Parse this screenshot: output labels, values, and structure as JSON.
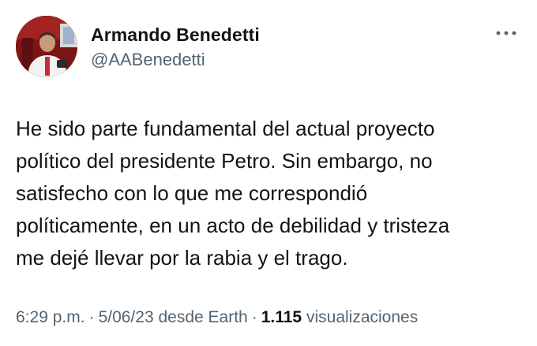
{
  "author": {
    "name": "Armando Benedetti",
    "handle": "@AABenedetti",
    "avatar_icon": "profile-photo"
  },
  "menu_icon": "more-options-icon",
  "tweet": {
    "lines": [
      "He sido parte fundamental del actual proyecto",
      "político del presidente Petro. Sin embargo, no",
      "satisfecho con lo que me correspondió",
      "políticamente, en un acto de debilidad y tristeza",
      "me dejé llevar por la rabia y el trago."
    ]
  },
  "meta": {
    "time": "6:29 p.m.",
    "separator": "·",
    "date_source": "5/06/23 desde Earth",
    "views_count": "1.115",
    "views_label": "visualizaciones"
  },
  "colors": {
    "text_primary": "#0f1419",
    "text_secondary": "#536471",
    "background": "#ffffff"
  }
}
